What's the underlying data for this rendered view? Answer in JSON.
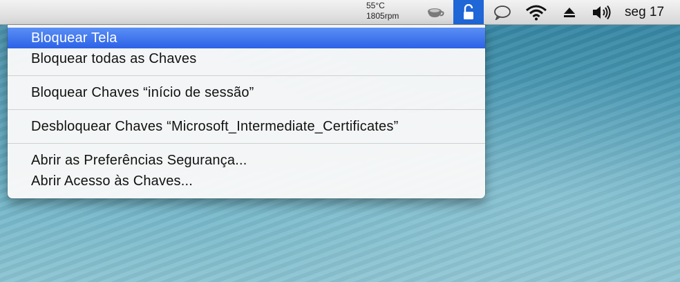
{
  "menubar": {
    "temperature": "55°C",
    "fan_speed": "1805rpm",
    "clock": "seg 17",
    "icons": [
      "coffee-cup-icon",
      "lock-icon",
      "speech-bubble-icon",
      "wifi-icon",
      "eject-icon",
      "volume-icon"
    ],
    "accent": "#1f66d7"
  },
  "menu": {
    "items": [
      {
        "label": "Bloquear Tela",
        "selected": true
      },
      {
        "label": "Bloquear todas as Chaves"
      },
      {
        "label": "Bloquear Chaves “início de sessão”"
      },
      {
        "label": "Desbloquear Chaves “Microsoft_Intermediate_Certificates”"
      },
      {
        "label": "Abrir as Preferências Segurança..."
      },
      {
        "label": "Abrir Acesso às Chaves..."
      }
    ]
  }
}
